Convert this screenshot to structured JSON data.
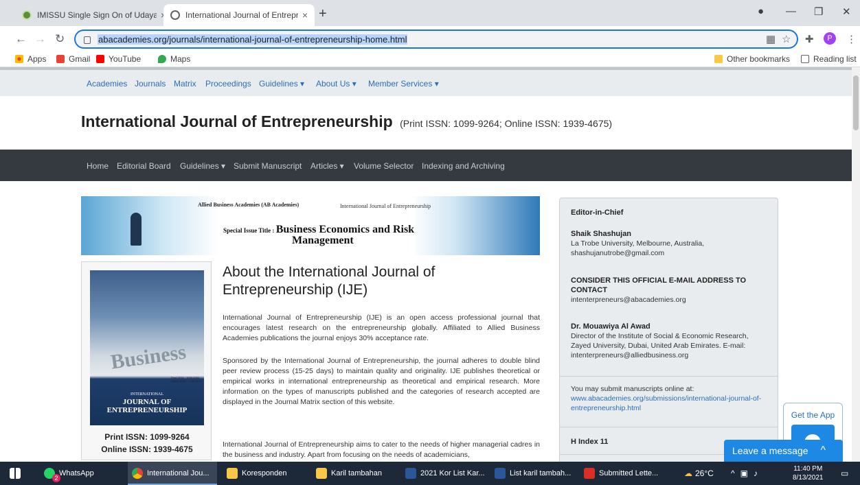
{
  "browser": {
    "tabs": [
      {
        "title": "IMISSU Single Sign On of Udayar",
        "close": "×"
      },
      {
        "title": "International Journal of Entrepre",
        "close": "×"
      }
    ],
    "new_tab": "+",
    "url": "abacademies.org/journals/international-journal-of-entrepreneurship-home.html",
    "profile_initial": "P",
    "bookmarks": [
      "Apps",
      "Gmail",
      "YouTube",
      "Maps"
    ],
    "other_bookmarks": "Other bookmarks",
    "reading_list": "Reading list"
  },
  "topnav": [
    "Academies",
    "Journals",
    "Matrix",
    "Proceedings",
    "Guidelines ▾",
    "About Us ▾",
    "Member Services ▾"
  ],
  "journal": {
    "title": "International Journal of Entrepreneurship",
    "issn_line": "(Print ISSN: 1099-9264; Online ISSN: 1939-4675)"
  },
  "journal_nav": [
    "Home",
    "Editorial Board",
    "Guidelines ▾",
    "Submit Manuscript",
    "Articles ▾",
    "Volume Selector",
    "Indexing and Archiving"
  ],
  "banner": {
    "publisher": "Allied Business Academies (AB Academies)",
    "journal_name": "International Journal of Entrepreneurship",
    "special_issue_label": "Special Issue Title :",
    "special_issue_title_1": "Business Economics and Risk",
    "special_issue_title_2": "Management"
  },
  "cover": {
    "business": "Business",
    "intl": "INTERNATIONAL",
    "journal_of": "JOURNAL OF",
    "entrepreneurship": "ENTREPRENEURSHIP",
    "mini_issn": "Print ISSN : 1099-9264 Online ISSN : 1939-4675",
    "print_issn": "Print ISSN: 1099-9264",
    "online_issn": "Online ISSN: 1939-4675"
  },
  "about": {
    "heading": "About the International Journal of Entrepreneurship (IJE)",
    "p1": "International Journal of Entrepreneurship (IJE) is an open access professional journal that encourages latest research on the entrepreneurship globally. Affiliated to Allied Business Academies publications the journal enjoys 30% acceptance rate.",
    "p2": "Sponsored by the International Journal of Entrepreneurship, the journal adheres to double blind peer review process (15-25 days) to maintain quality and originality. IJE publishes theoretical or empirical works in international entrepreneurship as theoretical and empirical research. More information on the types of manuscripts published and the categories of research accepted are displayed in the Journal Matrix section of this website.",
    "p3": "International Journal of Entrepreneurship aims to cater to the needs of higher managerial cadres in the business and industry. Apart from focusing on the needs of academicians,"
  },
  "sidebar": {
    "editor_label": "Editor-in-Chief",
    "editor_name": "Shaik Shashujan",
    "editor_affil": "La Trobe University, Melbourne, Australia,",
    "editor_email": "shashujanutrobe@gmail.com",
    "official_heading": "CONSIDER THIS OFFICIAL E-MAIL ADDRESS TO CONTACT",
    "official_email": "intenterpreneurs@abacademies.org",
    "second_name": "Dr. Mouawiya Al Awad",
    "second_affil": "Director of the Institute of Social & Economic Research, Zayed University, Dubai, United Arab Emirates. E-mail: intenterpreneurs@alliedbusiness.org",
    "submit_text": "You may submit manuscripts online at:",
    "submit_link": "www.abacademies.org/submissions/international-journal-of-entrepreneurship.html",
    "hindex": "H Index 11"
  },
  "widgets": {
    "get_app": "Get the App",
    "leave_message": "Leave a message",
    "leave_chevron": "^"
  },
  "taskbar": {
    "items": [
      "WhatsApp",
      "International Jou...",
      "Koresponden",
      "Karil tambahan",
      "2021 Kor List Kar...",
      "List karil tambah...",
      "Submitted Lette..."
    ],
    "whatsapp_badge": "2",
    "temperature": "26°C",
    "time": "11:40 PM",
    "date": "8/13/2021"
  }
}
